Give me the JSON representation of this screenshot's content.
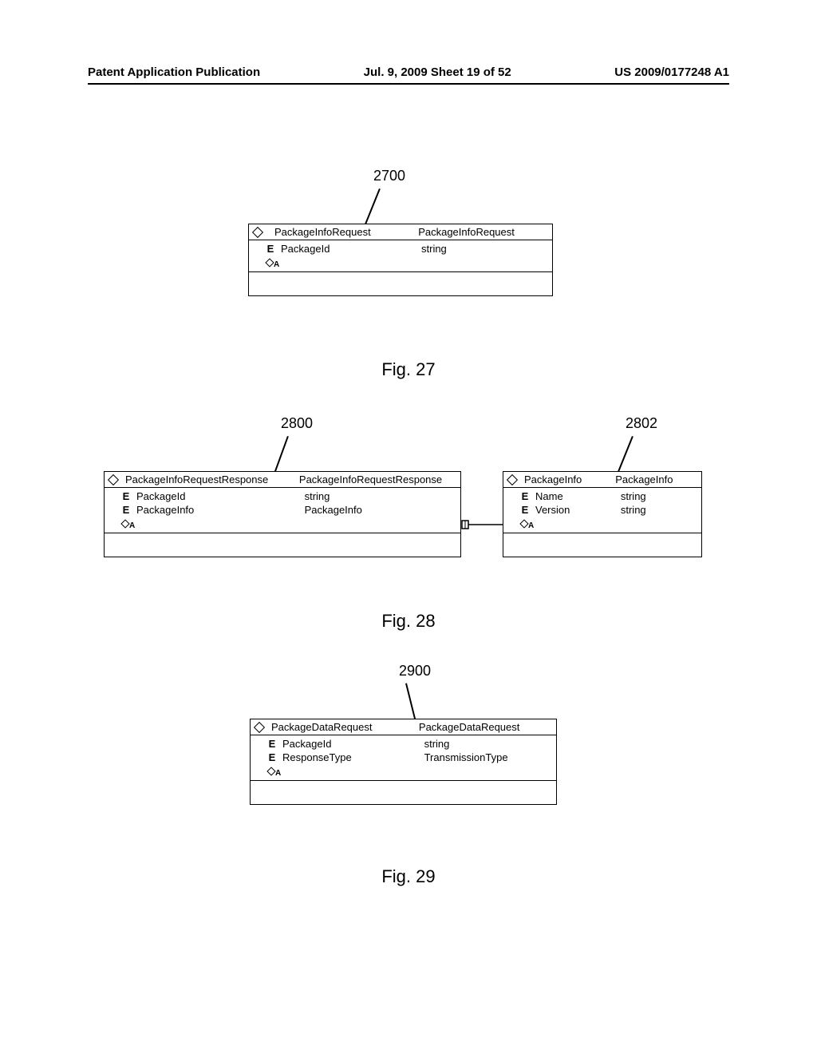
{
  "header": {
    "left": "Patent Application Publication",
    "center": "Jul. 9, 2009  Sheet 19 of 52",
    "right": "US 2009/0177248 A1"
  },
  "fig27": {
    "ref": "2700",
    "caption": "Fig. 27",
    "class": {
      "name": "PackageInfoRequest",
      "type": "PackageInfoRequest",
      "attrs": [
        {
          "name": "PackageId",
          "type": "string"
        }
      ]
    }
  },
  "fig28": {
    "refA": "2800",
    "refB": "2802",
    "caption": "Fig. 28",
    "classA": {
      "name": "PackageInfoRequestResponse",
      "type": "PackageInfoRequestResponse",
      "attrs": [
        {
          "name": "PackageId",
          "type": "string"
        },
        {
          "name": "PackageInfo",
          "type": "PackageInfo"
        }
      ]
    },
    "classB": {
      "name": "PackageInfo",
      "type": "PackageInfo",
      "attrs": [
        {
          "name": "Name",
          "type": "string"
        },
        {
          "name": "Version",
          "type": "string"
        }
      ]
    }
  },
  "fig29": {
    "ref": "2900",
    "caption": "Fig. 29",
    "class": {
      "name": "PackageDataRequest",
      "type": "PackageDataRequest",
      "attrs": [
        {
          "name": "PackageId",
          "type": "string"
        },
        {
          "name": "ResponseType",
          "type": "TransmissionType"
        }
      ]
    }
  }
}
